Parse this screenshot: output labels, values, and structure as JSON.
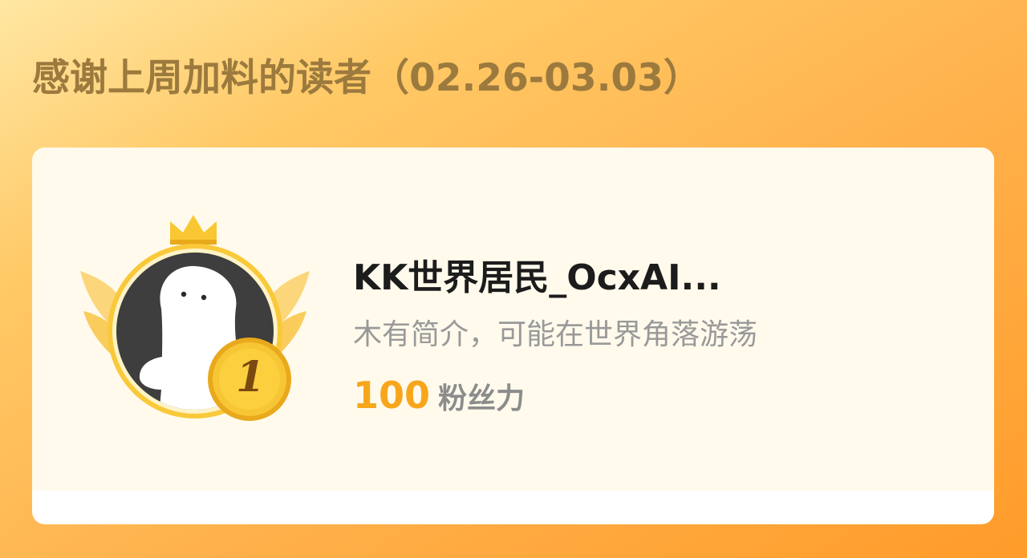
{
  "header": {
    "title": "感谢上周加料的读者（02.26-03.03）"
  },
  "reader": {
    "rank": "1",
    "name": "KK世界居民_OcxAI...",
    "bio": "木有简介，可能在世界角落游荡",
    "fans_power_value": "100",
    "fans_power_label": "粉丝力"
  },
  "colors": {
    "accent": "#f7a61c",
    "title": "#9c7a3e",
    "card_bg": "#fffaec",
    "gold": "#f6c22c"
  },
  "icons": {
    "crown": "crown-icon",
    "wings": "wings-icon",
    "avatar": "avatar",
    "medal": "rank-medal-icon"
  }
}
